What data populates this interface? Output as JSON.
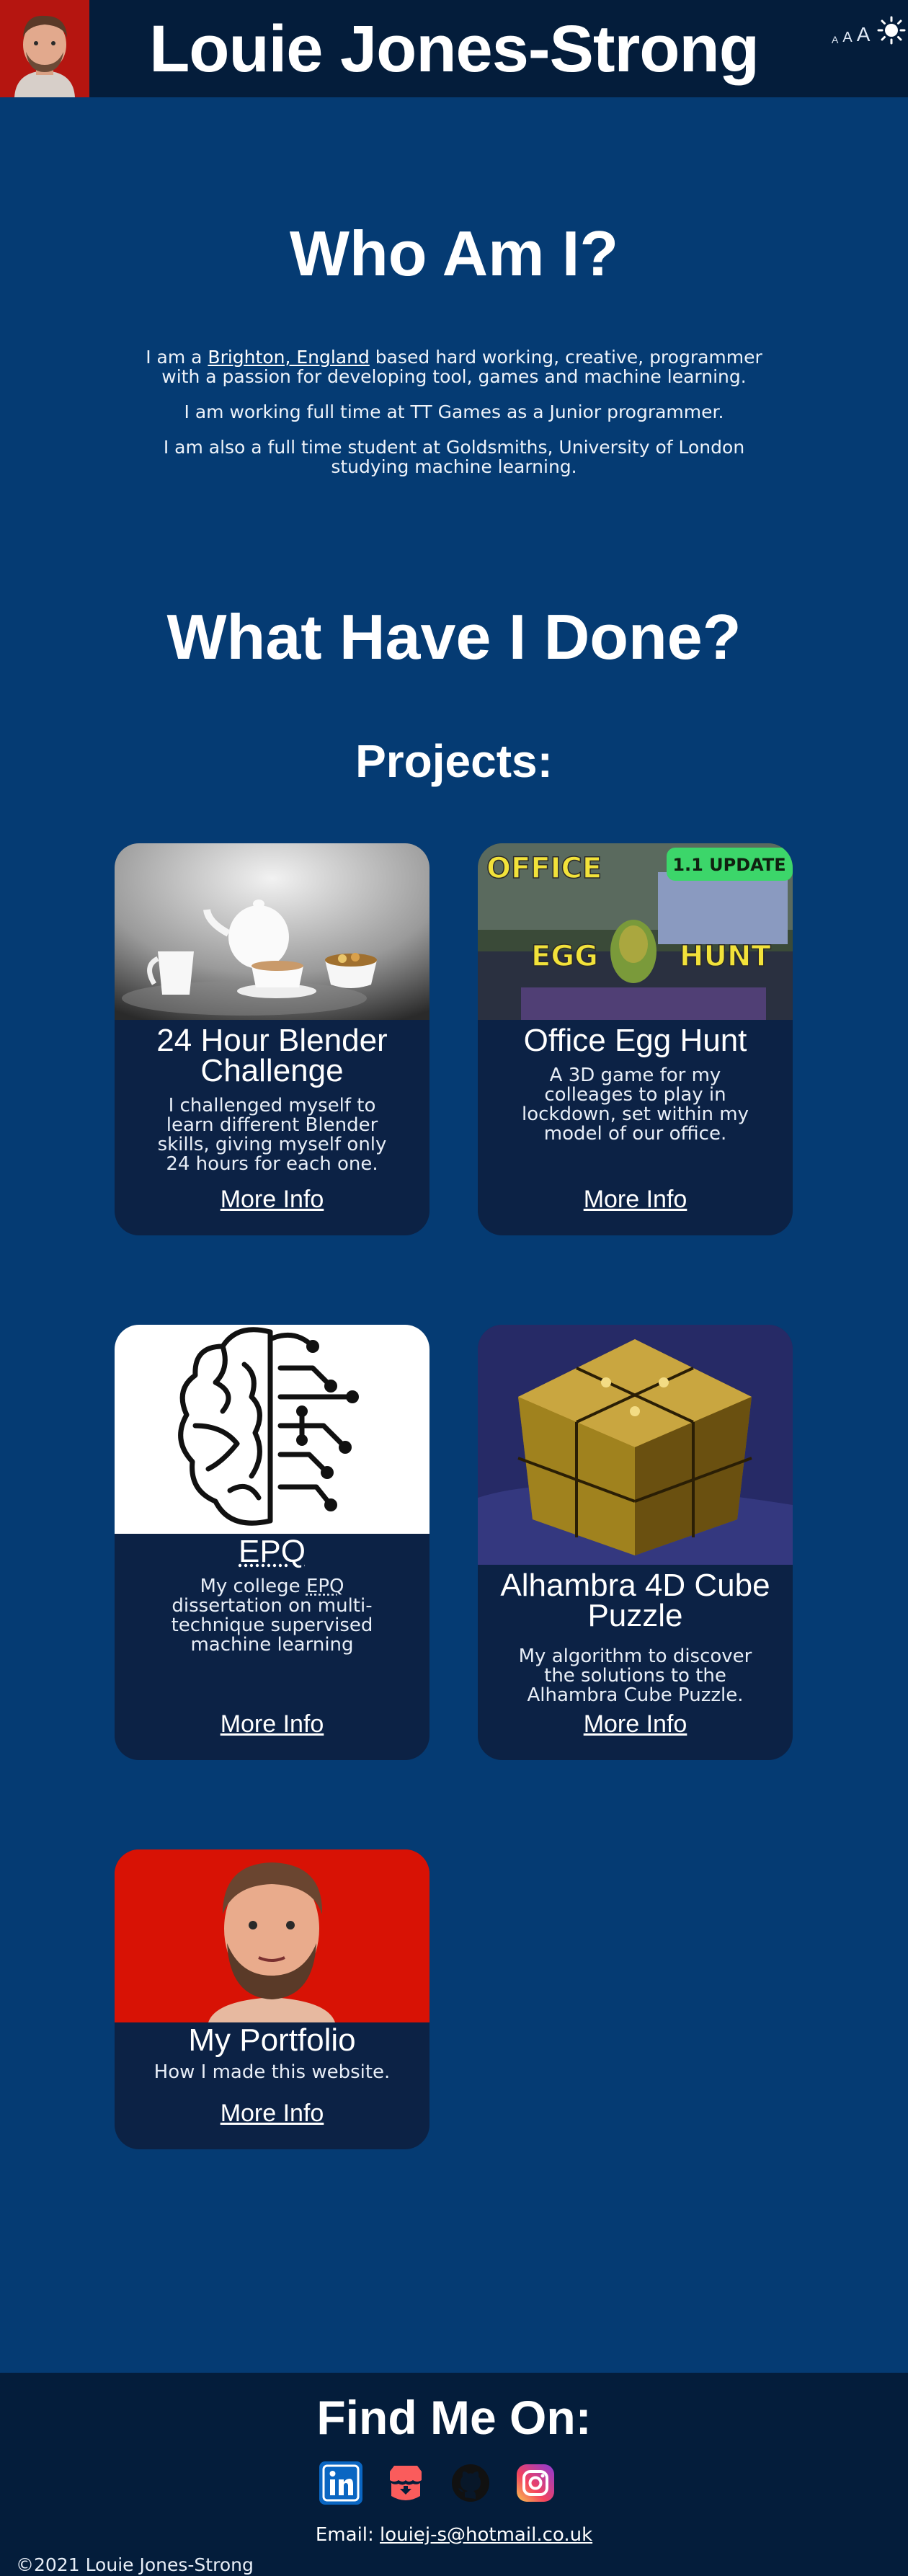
{
  "header": {
    "title": "Louie Jones-Strong",
    "font_controls": [
      "A",
      "A",
      "A"
    ],
    "theme_icon": "sun-icon"
  },
  "about": {
    "heading": "Who Am I?",
    "p1_prefix": "I am a ",
    "p1_link": "Brighton, England",
    "p1_suffix": " based hard working, creative, programmer with a passion for developing tool, games and machine learning.",
    "p2": "I am working full time at TT Games as a Junior programmer.",
    "p3": "I am also a full time student at Goldsmiths, University of London studying machine learning."
  },
  "work": {
    "heading": "What Have I Done?",
    "subheading": "Projects:"
  },
  "projects": [
    {
      "title": "24 Hour Blender Challenge",
      "desc": "I challenged myself to learn different Blender skills, giving myself only 24 hours for each one.",
      "more": "More Info"
    },
    {
      "title": "Office Egg Hunt",
      "desc": "A 3D game for my colleages to play in lockdown, set within my model of our office.",
      "more": "More Info",
      "img_text": {
        "top": "OFFICE",
        "badge": "1.1 UPDATE",
        "left": "EGG",
        "right": "HUNT"
      }
    },
    {
      "title": "EPQ",
      "desc_prefix": "My college ",
      "desc_abbr": "EPQ",
      "desc_suffix": " dissertation on multi-technique supervised machine learning",
      "more": "More Info"
    },
    {
      "title": "Alhambra 4D Cube Puzzle",
      "desc": "My algorithm to discover the solutions to the Alhambra Cube Puzzle.",
      "more": "More Info"
    },
    {
      "title": "My Portfolio",
      "desc": "How I made this website.",
      "more": "More Info"
    }
  ],
  "footer": {
    "heading": "Find Me On:",
    "social": [
      "linkedin-icon",
      "itch-io-icon",
      "github-icon",
      "instagram-icon"
    ],
    "email_label": "Email: ",
    "email": "louiej-s@hotmail.co.uk",
    "copyright": "©2021 Louie Jones-Strong"
  },
  "colors": {
    "background": "#053b73",
    "header_footer": "#041d3b",
    "card": "#0c2245"
  }
}
